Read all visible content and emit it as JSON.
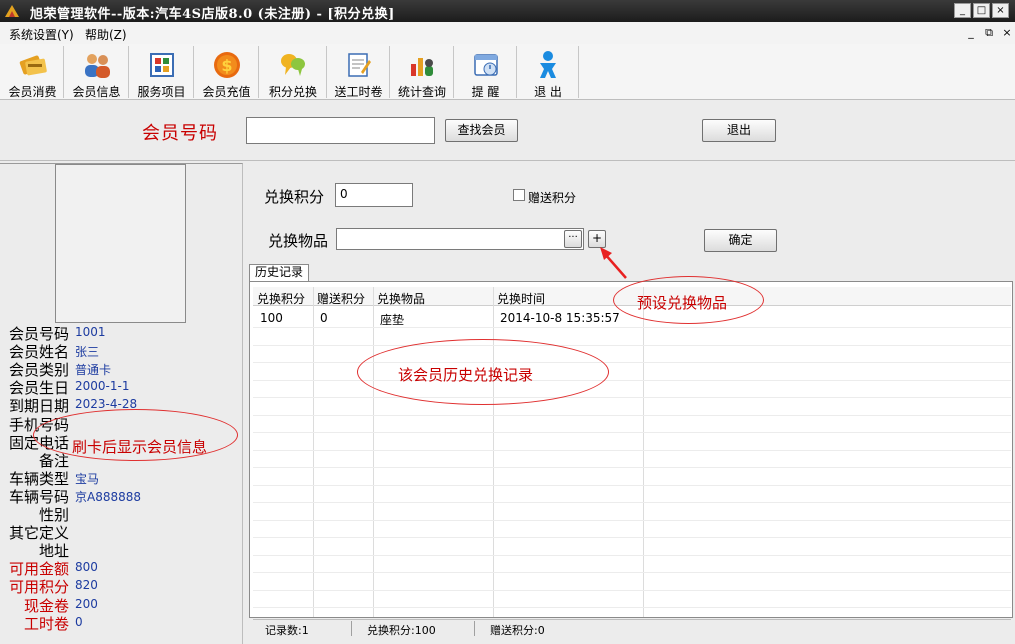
{
  "window": {
    "title": "旭荣管理软件--版本:汽车4S店版8.0 (未注册) - [积分兑换]",
    "controls": [
      "_",
      "□",
      "×"
    ],
    "mdi_controls": [
      "_",
      "⧉",
      "×"
    ]
  },
  "menu": {
    "items": [
      "系统设置(Y)",
      "帮助(Z)"
    ]
  },
  "toolbar": {
    "items": [
      {
        "label": "会员消费",
        "icon": "member-consume-icon"
      },
      {
        "label": "会员信息",
        "icon": "member-info-icon"
      },
      {
        "label": "服务项目",
        "icon": "service-items-icon"
      },
      {
        "label": "会员充值",
        "icon": "recharge-icon"
      },
      {
        "label": "积分兑换",
        "icon": "points-exchange-icon"
      },
      {
        "label": "送工时卷",
        "icon": "labor-voucher-icon"
      },
      {
        "label": "统计查询",
        "icon": "statistics-icon"
      },
      {
        "label": "提  醒",
        "icon": "reminder-icon"
      },
      {
        "label": "退  出",
        "icon": "exit-icon"
      }
    ]
  },
  "search": {
    "label": "会员号码",
    "value": "",
    "find_button": "查找会员",
    "exit_button": "退出"
  },
  "member_info": [
    {
      "label": "会员号码",
      "value": "1001",
      "red": false
    },
    {
      "label": "会员姓名",
      "value": "张三",
      "red": false
    },
    {
      "label": "会员类别",
      "value": "普通卡",
      "red": false
    },
    {
      "label": "会员生日",
      "value": "2000-1-1",
      "red": false
    },
    {
      "label": "到期日期",
      "value": "2023-4-28",
      "red": false
    },
    {
      "label": "手机号码",
      "value": "",
      "red": false
    },
    {
      "label": "固定电话",
      "value": "",
      "red": false
    },
    {
      "label": "备注",
      "value": "",
      "red": false
    },
    {
      "label": "车辆类型",
      "value": "宝马",
      "red": false
    },
    {
      "label": "车辆号码",
      "value": "京A888888",
      "red": false
    },
    {
      "label": "性别",
      "value": "",
      "red": false
    },
    {
      "label": "其它定义",
      "value": "",
      "red": false
    },
    {
      "label": "地址",
      "value": "",
      "red": false
    },
    {
      "label": "可用金额",
      "value": "800",
      "red": true
    },
    {
      "label": "可用积分",
      "value": "820",
      "red": true
    },
    {
      "label": "现金卷",
      "value": "200",
      "red": true
    },
    {
      "label": "工时卷",
      "value": "0",
      "red": true
    }
  ],
  "exchange": {
    "points_label": "兑换积分",
    "points_value": "0",
    "gift_checkbox_label": "赠送积分",
    "gift_checked": false,
    "item_label": "兑换物品",
    "item_value": "",
    "browse_button": "···",
    "add_button": "+",
    "confirm_button": "确定"
  },
  "history": {
    "tab_label": "历史记录",
    "columns": [
      "兑换积分",
      "赠送积分",
      "兑换物品",
      "兑换时间"
    ],
    "rows": [
      [
        "100",
        "0",
        "座垫",
        "2014-10-8 15:35:57"
      ]
    ]
  },
  "status": {
    "record_count": "记录数:1",
    "exchange_points": "兑换积分:100",
    "gift_points": "赠送积分:0"
  },
  "annotations": {
    "preset_item": "预设兑换物品",
    "history_note": "该会员历史兑换记录",
    "card_note": "刷卡后显示会员信息"
  }
}
